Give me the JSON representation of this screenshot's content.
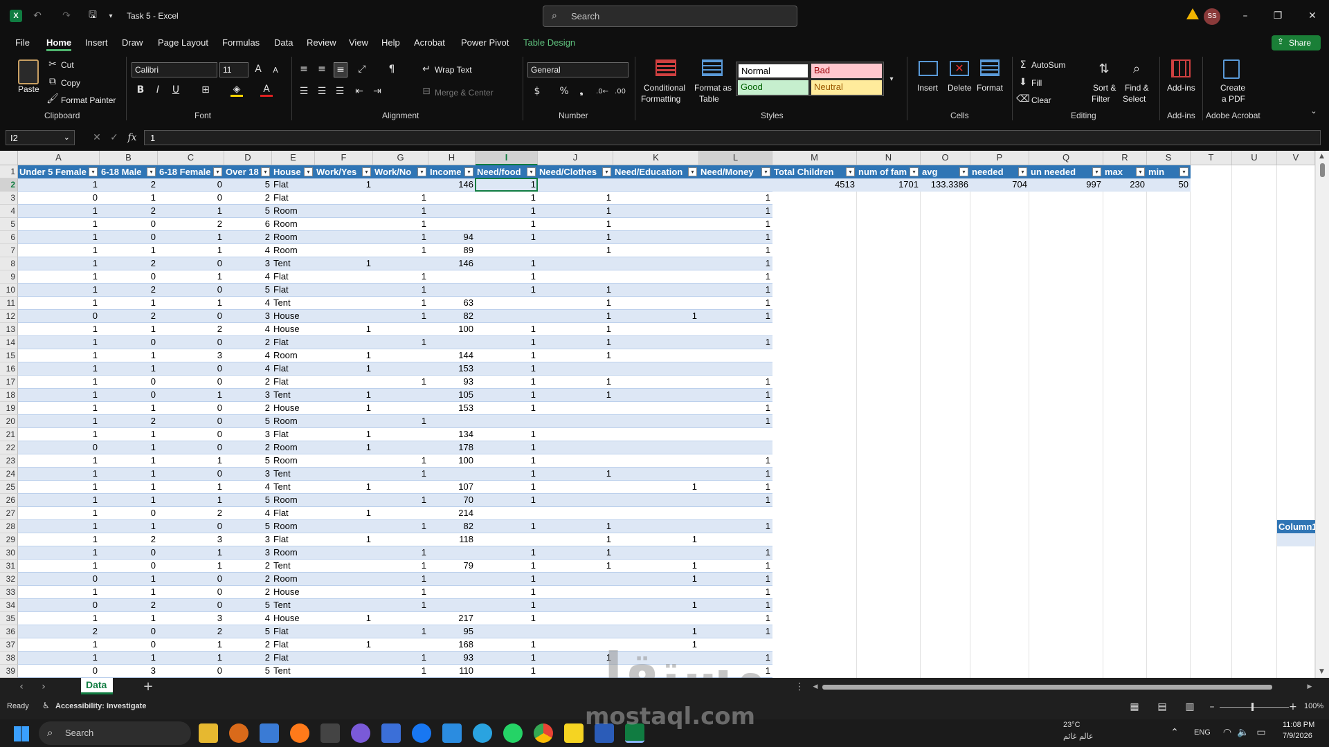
{
  "title": {
    "doc": "Task 5 - Excel",
    "search_placeholder": "Search",
    "user_initials": "SS"
  },
  "menu": [
    "File",
    "Home",
    "Insert",
    "Draw",
    "Page Layout",
    "Formulas",
    "Data",
    "Review",
    "View",
    "Help",
    "Acrobat",
    "Power Pivot",
    "Table Design"
  ],
  "share": "Share",
  "ribbon": {
    "paste": "Paste",
    "cut": "Cut",
    "copy": "Copy",
    "format_painter": "Format Painter",
    "clipboard": "Clipboard",
    "font_name": "Calibri",
    "font_size": "11",
    "font": "Font",
    "wrap_text": "Wrap Text",
    "merge_center": "Merge & Center",
    "alignment": "Alignment",
    "number_format": "General",
    "number": "Number",
    "conditional": "Conditional",
    "formatting": "Formatting",
    "format_as": "Format as",
    "table": "Table",
    "styles": "Styles",
    "style_normal": "Normal",
    "style_bad": "Bad",
    "style_good": "Good",
    "style_neutral": "Neutral",
    "insert": "Insert",
    "delete": "Delete",
    "format": "Format",
    "cells": "Cells",
    "autosum": "AutoSum",
    "fill": "Fill",
    "clear": "Clear",
    "sort_filter": "Sort &",
    "filter": "Filter",
    "find_select": "Find &",
    "select": "Select",
    "editing": "Editing",
    "addins": "Add-ins",
    "addins_grp": "Add-ins",
    "create": "Create",
    "pdf": "a PDF",
    "acrobat": "Adobe Acrobat"
  },
  "formula_bar": {
    "name_box": "I2",
    "formula": "1"
  },
  "columns": [
    "A",
    "B",
    "C",
    "D",
    "E",
    "F",
    "G",
    "H",
    "I",
    "J",
    "K",
    "L",
    "M",
    "N",
    "O",
    "P",
    "Q",
    "R",
    "S",
    "T",
    "U",
    "V"
  ],
  "headers": [
    "Under 5 Female",
    "6-18 Male",
    "6-18 Female",
    "Over 18",
    "House",
    "Work/Yes",
    "Work/No",
    "Income",
    "Need/food",
    "Need/Clothes",
    "Need/Education",
    "Need/Money",
    "Total Children",
    "num of fam",
    "avg",
    "needed",
    "un needed",
    "max",
    "min"
  ],
  "summary": [
    "4513",
    "1701",
    "133.3386",
    "704",
    "997",
    "230",
    "50"
  ],
  "column1": "Column1",
  "rows": [
    [
      "1",
      "2",
      "0",
      "5",
      "Flat",
      "1",
      "",
      "146",
      "1",
      "",
      "",
      ""
    ],
    [
      "0",
      "1",
      "0",
      "2",
      "Flat",
      "",
      "1",
      "",
      "1",
      "1",
      "",
      "1"
    ],
    [
      "1",
      "2",
      "1",
      "5",
      "Room",
      "",
      "1",
      "",
      "1",
      "1",
      "",
      "1"
    ],
    [
      "1",
      "0",
      "2",
      "6",
      "Room",
      "",
      "1",
      "",
      "1",
      "1",
      "",
      "1"
    ],
    [
      "1",
      "0",
      "1",
      "2",
      "Room",
      "",
      "1",
      "94",
      "1",
      "1",
      "",
      "1"
    ],
    [
      "1",
      "1",
      "1",
      "4",
      "Room",
      "",
      "1",
      "89",
      "",
      "1",
      "",
      "1"
    ],
    [
      "1",
      "2",
      "0",
      "3",
      "Tent",
      "1",
      "",
      "146",
      "1",
      "",
      "",
      "1"
    ],
    [
      "1",
      "0",
      "1",
      "4",
      "Flat",
      "",
      "1",
      "",
      "1",
      "",
      "",
      "1"
    ],
    [
      "1",
      "2",
      "0",
      "5",
      "Flat",
      "",
      "1",
      "",
      "1",
      "1",
      "",
      "1"
    ],
    [
      "1",
      "1",
      "1",
      "4",
      "Tent",
      "",
      "1",
      "63",
      "",
      "1",
      "",
      "1"
    ],
    [
      "0",
      "2",
      "0",
      "3",
      "House",
      "",
      "1",
      "82",
      "",
      "1",
      "1",
      "1"
    ],
    [
      "1",
      "1",
      "2",
      "4",
      "House",
      "1",
      "",
      "100",
      "1",
      "1",
      "",
      ""
    ],
    [
      "1",
      "0",
      "0",
      "2",
      "Flat",
      "",
      "1",
      "",
      "1",
      "1",
      "",
      "1"
    ],
    [
      "1",
      "1",
      "3",
      "4",
      "Room",
      "1",
      "",
      "144",
      "1",
      "1",
      "",
      ""
    ],
    [
      "1",
      "1",
      "0",
      "4",
      "Flat",
      "1",
      "",
      "153",
      "1",
      "",
      "",
      ""
    ],
    [
      "1",
      "0",
      "0",
      "2",
      "Flat",
      "",
      "1",
      "93",
      "1",
      "1",
      "",
      "1"
    ],
    [
      "1",
      "0",
      "1",
      "3",
      "Tent",
      "1",
      "",
      "105",
      "1",
      "1",
      "",
      "1"
    ],
    [
      "1",
      "1",
      "0",
      "2",
      "House",
      "1",
      "",
      "153",
      "1",
      "",
      "",
      "1"
    ],
    [
      "1",
      "2",
      "0",
      "5",
      "Room",
      "",
      "1",
      "",
      "",
      "",
      "",
      "1"
    ],
    [
      "1",
      "1",
      "0",
      "3",
      "Flat",
      "1",
      "",
      "134",
      "1",
      "",
      "",
      ""
    ],
    [
      "0",
      "1",
      "0",
      "2",
      "Room",
      "1",
      "",
      "178",
      "1",
      "",
      "",
      ""
    ],
    [
      "1",
      "1",
      "1",
      "5",
      "Room",
      "",
      "1",
      "100",
      "1",
      "",
      "",
      "1"
    ],
    [
      "1",
      "1",
      "0",
      "3",
      "Tent",
      "",
      "1",
      "",
      "1",
      "1",
      "",
      "1"
    ],
    [
      "1",
      "1",
      "1",
      "4",
      "Tent",
      "1",
      "",
      "107",
      "1",
      "",
      "1",
      "1"
    ],
    [
      "1",
      "1",
      "1",
      "5",
      "Room",
      "",
      "1",
      "70",
      "1",
      "",
      "",
      "1"
    ],
    [
      "1",
      "0",
      "2",
      "4",
      "Flat",
      "1",
      "",
      "214",
      "",
      "",
      "",
      ""
    ],
    [
      "1",
      "1",
      "0",
      "5",
      "Room",
      "",
      "1",
      "82",
      "1",
      "1",
      "",
      "1"
    ],
    [
      "1",
      "2",
      "3",
      "3",
      "Flat",
      "1",
      "",
      "118",
      "",
      "1",
      "1",
      ""
    ],
    [
      "1",
      "0",
      "1",
      "3",
      "Room",
      "",
      "1",
      "",
      "1",
      "1",
      "",
      "1"
    ],
    [
      "1",
      "0",
      "1",
      "2",
      "Tent",
      "",
      "1",
      "79",
      "1",
      "1",
      "1",
      "1"
    ],
    [
      "0",
      "1",
      "0",
      "2",
      "Room",
      "",
      "1",
      "",
      "1",
      "",
      "1",
      "1"
    ],
    [
      "1",
      "1",
      "0",
      "2",
      "House",
      "",
      "1",
      "",
      "1",
      "",
      "",
      "1"
    ],
    [
      "0",
      "2",
      "0",
      "5",
      "Tent",
      "",
      "1",
      "",
      "1",
      "",
      "1",
      "1"
    ],
    [
      "1",
      "1",
      "3",
      "4",
      "House",
      "1",
      "",
      "217",
      "1",
      "",
      "",
      "1"
    ],
    [
      "2",
      "0",
      "2",
      "5",
      "Flat",
      "",
      "1",
      "95",
      "",
      "",
      "1",
      "1"
    ],
    [
      "1",
      "0",
      "1",
      "2",
      "Flat",
      "1",
      "",
      "168",
      "1",
      "",
      "1",
      ""
    ],
    [
      "1",
      "1",
      "1",
      "2",
      "Flat",
      "",
      "1",
      "93",
      "1",
      "1",
      "",
      "1"
    ],
    [
      "0",
      "3",
      "0",
      "5",
      "Tent",
      "",
      "1",
      "110",
      "1",
      "",
      "",
      "1"
    ]
  ],
  "sheet_tab": "Data",
  "status": {
    "ready": "Ready",
    "accessibility": "Accessibility: Investigate",
    "zoom": "100%"
  },
  "taskbar": {
    "search": "Search",
    "temp": "23°C",
    "weather": "عالم غائم",
    "lang": "ENG",
    "time": "11:08 PM",
    "date": "7/9/2026"
  },
  "watermark": {
    "arabic": "مستقل",
    "latin": "mostaql.com"
  }
}
